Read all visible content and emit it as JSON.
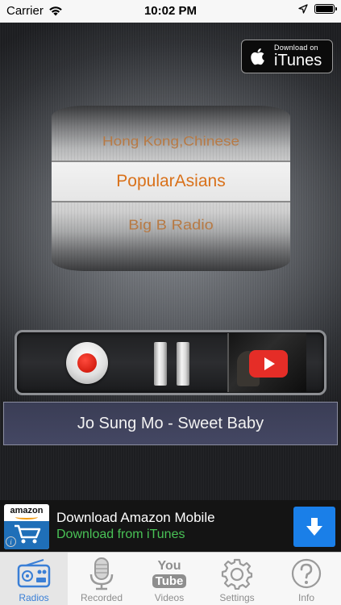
{
  "status_bar": {
    "carrier": "Carrier",
    "time": "10:02 PM"
  },
  "itunes_badge": {
    "small_text": "Download on",
    "big_text": "iTunes"
  },
  "picker": {
    "items": [
      "Hong Kong,Chinese",
      "PopularAsians",
      "Big B Radio"
    ],
    "selected": "PopularAsians"
  },
  "now_playing": {
    "track": "Jo Sung Mo - Sweet Baby"
  },
  "ad": {
    "logo_text": "amazon",
    "title": "Download Amazon Mobile",
    "subtitle": "Download from iTunes"
  },
  "tab_bar": {
    "tabs": [
      {
        "label": "Radios",
        "icon": "radio-icon",
        "active": true
      },
      {
        "label": "Recorded",
        "icon": "microphone-icon",
        "active": false
      },
      {
        "label": "Videos",
        "icon": "youtube-icon",
        "active": false
      },
      {
        "label": "Settings",
        "icon": "gear-icon",
        "active": false
      },
      {
        "label": "Info",
        "icon": "question-icon",
        "active": false
      }
    ],
    "youtube_icon_text_top": "You",
    "youtube_icon_text_bottom": "Tube"
  },
  "colors": {
    "accent_blue": "#3a7fd6",
    "picker_orange": "#d9711a",
    "ad_green": "#49c256",
    "record_red": "#e0180c",
    "youtube_red": "#e52d27"
  }
}
